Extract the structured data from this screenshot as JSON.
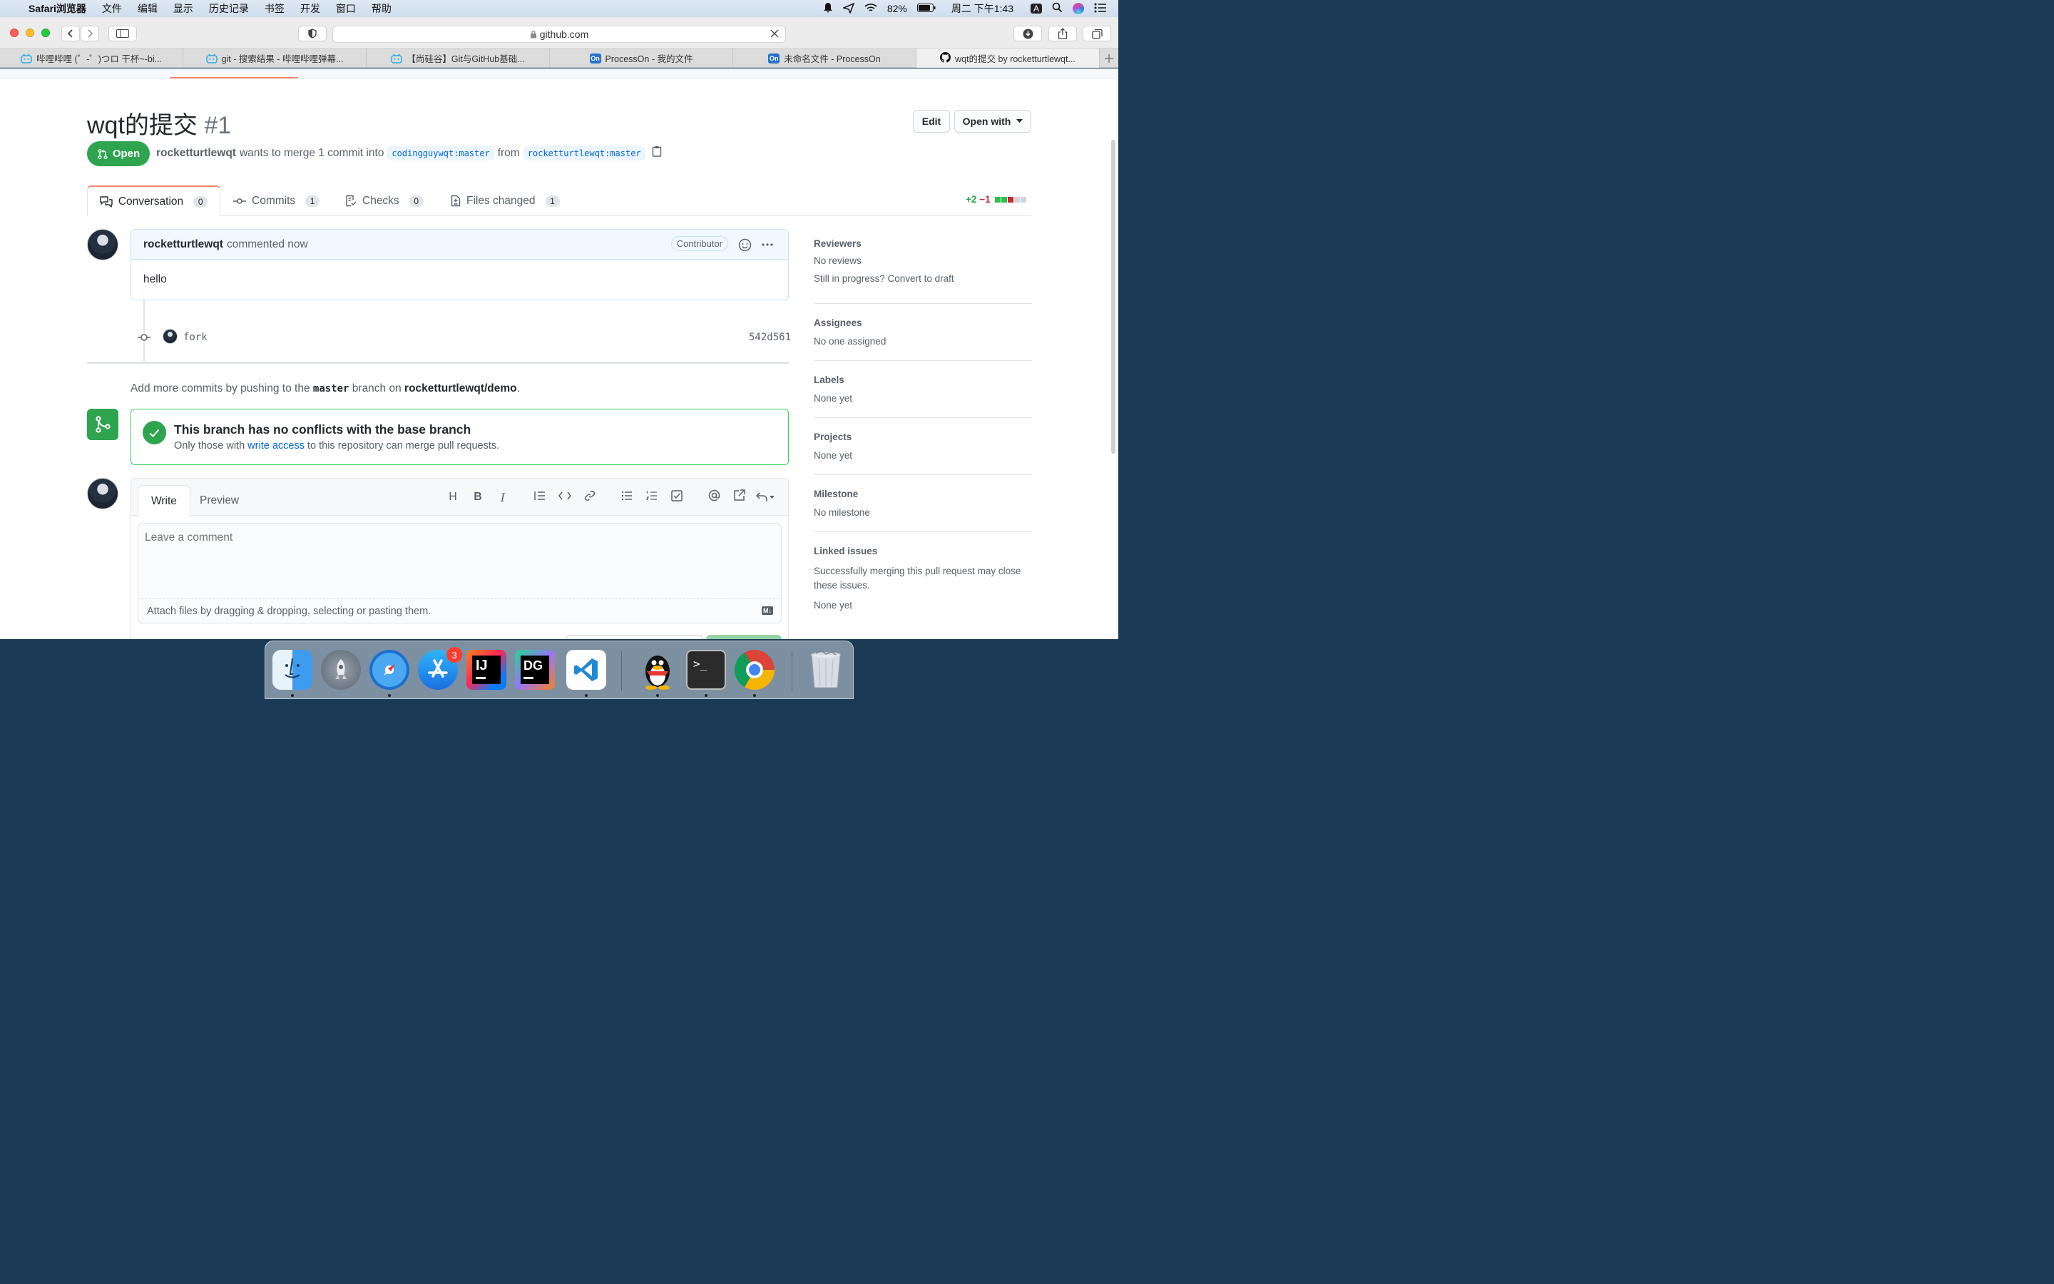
{
  "menubar": {
    "app": "Safari浏览器",
    "items": [
      "文件",
      "编辑",
      "显示",
      "历史记录",
      "书签",
      "开发",
      "窗口",
      "帮助"
    ],
    "battery": "82%",
    "datetime": "周二 下午1:43",
    "input_method": "A"
  },
  "browser": {
    "url": "github.com",
    "tabs": [
      {
        "label": "哔哩哔哩 (゜-゜)つロ 干杯~-bi...",
        "icon": "bilibili-icon"
      },
      {
        "label": "git - 搜索结果 - 哔哩哔哩弹幕...",
        "icon": "bilibili-icon"
      },
      {
        "label": "【尚硅谷】Git与GitHub基础...",
        "icon": "bilibili-icon"
      },
      {
        "label": "ProcessOn - 我的文件",
        "icon": "processon-icon",
        "icon_text": "On"
      },
      {
        "label": "未命名文件 - ProcessOn",
        "icon": "processon-icon",
        "icon_text": "On"
      },
      {
        "label": "wqt的提交 by rocketturtlewqt...",
        "icon": "github-icon",
        "active": true
      }
    ]
  },
  "pr": {
    "title": "wqt的提交",
    "number": "#1",
    "edit_label": "Edit",
    "open_with_label": "Open with",
    "state": "Open",
    "author": "rocketturtlewqt",
    "merge_text": "wants to merge 1 commit into",
    "base_branch": "codingguywqt:master",
    "from_text": "from",
    "head_branch": "rocketturtlewqt:master",
    "tabs": [
      {
        "label": "Conversation",
        "count": "0"
      },
      {
        "label": "Commits",
        "count": "1"
      },
      {
        "label": "Checks",
        "count": "0"
      },
      {
        "label": "Files changed",
        "count": "1"
      }
    ],
    "diffstat_add": "+2",
    "diffstat_del": "−1"
  },
  "comment": {
    "author": "rocketturtlewqt",
    "time": "commented now",
    "badge": "Contributor",
    "body": "hello"
  },
  "commit": {
    "message": "fork",
    "sha": "542d561"
  },
  "hint": {
    "prefix": "Add more commits by pushing to the",
    "branch": "master",
    "middle": "branch on",
    "repo": "rocketturtlewqt/demo",
    "suffix": "."
  },
  "merge": {
    "title": "This branch has no conflicts with the base branch",
    "desc_prefix": "Only those with",
    "desc_link": "write access",
    "desc_suffix": "to this repository can merge pull requests."
  },
  "editor": {
    "write_tab": "Write",
    "preview_tab": "Preview",
    "placeholder": "Leave a comment",
    "attach_text": "Attach files by dragging & dropping, selecting or pasting them.",
    "md_badge": "M↓"
  },
  "sidebar": {
    "sections": [
      {
        "heading": "Reviewers",
        "lines": [
          "No reviews",
          "Still in progress? Convert to draft"
        ]
      },
      {
        "heading": "Assignees",
        "lines": [
          "No one assigned"
        ]
      },
      {
        "heading": "Labels",
        "lines": [
          "None yet"
        ]
      },
      {
        "heading": "Projects",
        "lines": [
          "None yet"
        ]
      },
      {
        "heading": "Milestone",
        "lines": [
          "No milestone"
        ]
      },
      {
        "heading": "Linked issues",
        "lines": [
          "Successfully merging this pull request may close these issues.",
          "None yet"
        ]
      }
    ]
  },
  "dock": {
    "app_store_badge": "3",
    "apps": [
      "Finder",
      "Launchpad",
      "Safari",
      "App Store",
      "IntelliJ IDEA",
      "DataGrip",
      "VS Code",
      "QQ",
      "Terminal",
      "Chrome",
      "Trash"
    ]
  },
  "colors": {
    "open_green": "#2ea44f",
    "link_blue": "#0366d6",
    "merge_border": "#34d058",
    "tab_underline": "#f9826c"
  }
}
